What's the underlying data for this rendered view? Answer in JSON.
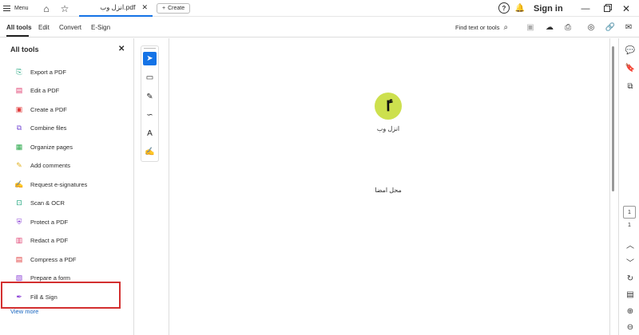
{
  "titlebar": {
    "menu_label": "Menu",
    "tab_title": "انزل وب.pdf",
    "create_label": "Create",
    "sign_in": "Sign in"
  },
  "toolbar": {
    "tabs": [
      "All tools",
      "Edit",
      "Convert",
      "E-Sign"
    ],
    "find_label": "Find text or tools"
  },
  "left_panel": {
    "title": "All tools",
    "tools": [
      {
        "label": "Export a PDF",
        "icon": "export-pdf-icon",
        "color": "#1aa37a"
      },
      {
        "label": "Edit a PDF",
        "icon": "edit-pdf-icon",
        "color": "#e03c6e"
      },
      {
        "label": "Create a PDF",
        "icon": "create-pdf-icon",
        "color": "#e03c3c"
      },
      {
        "label": "Combine files",
        "icon": "combine-files-icon",
        "color": "#7a4fd6"
      },
      {
        "label": "Organize pages",
        "icon": "organize-pages-icon",
        "color": "#2aa84a"
      },
      {
        "label": "Add comments",
        "icon": "add-comments-icon",
        "color": "#e0b020"
      },
      {
        "label": "Request e-signatures",
        "icon": "request-esign-icon",
        "color": "#8a3fd6"
      },
      {
        "label": "Scan & OCR",
        "icon": "scan-ocr-icon",
        "color": "#1aa37a"
      },
      {
        "label": "Protect a PDF",
        "icon": "protect-pdf-icon",
        "color": "#8a3fd6"
      },
      {
        "label": "Redact a PDF",
        "icon": "redact-pdf-icon",
        "color": "#e03c6e"
      },
      {
        "label": "Compress a PDF",
        "icon": "compress-pdf-icon",
        "color": "#e03c3c"
      },
      {
        "label": "Prepare a form",
        "icon": "prepare-form-icon",
        "color": "#8a3fd6"
      },
      {
        "label": "Fill & Sign",
        "icon": "fill-sign-icon",
        "color": "#8a3fd6"
      }
    ],
    "view_more": "View more"
  },
  "document": {
    "logo_glyph": "ٵ",
    "logo_text": "انزل وب",
    "signature_text": "محل امضا"
  },
  "rail": {
    "current_page": "1",
    "total_pages": "1"
  },
  "colors": {
    "accent": "#1473e6",
    "highlight": "#d32f2f",
    "logo_bg": "#cde04e"
  }
}
